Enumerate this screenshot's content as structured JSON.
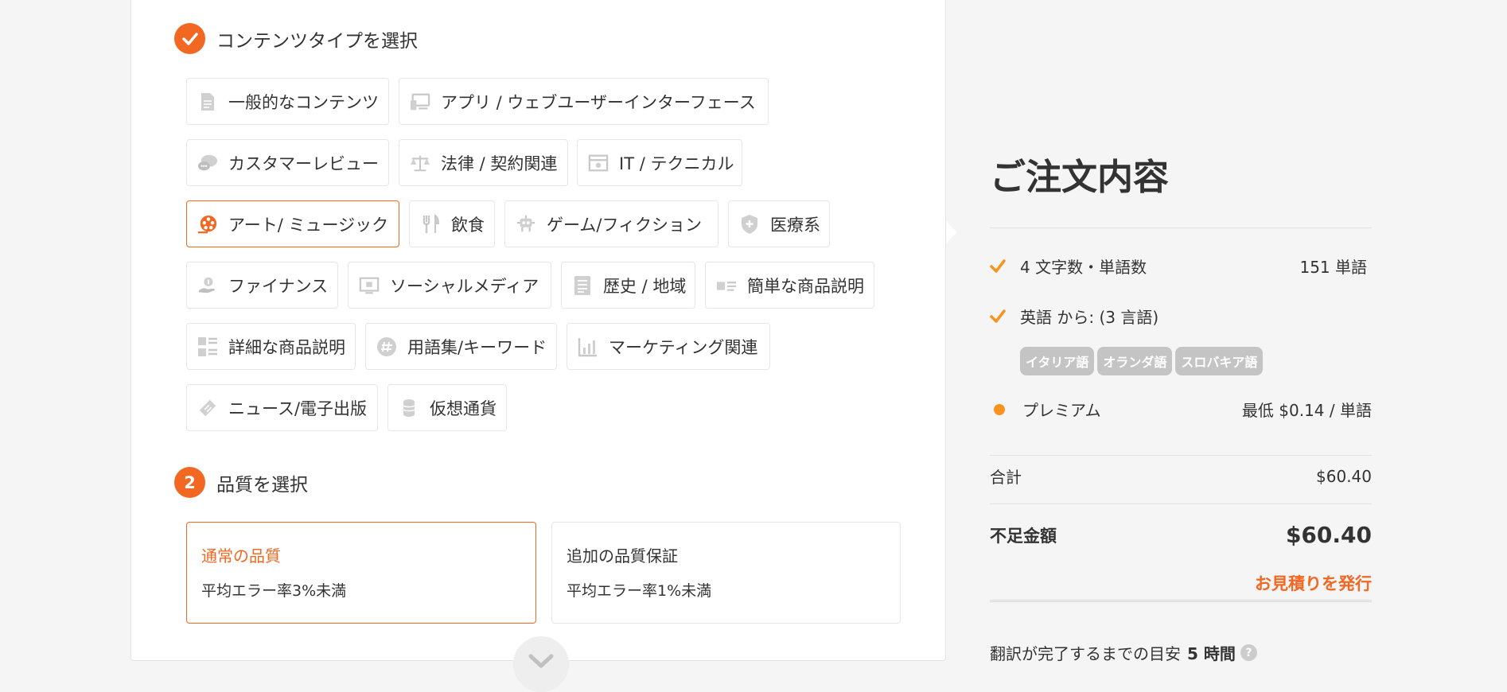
{
  "content_type": {
    "step_title": "コンテンツタイプを選択",
    "chips": [
      {
        "label": "一般的なコンテンツ",
        "icon": "document-icon"
      },
      {
        "label": "アプリ / ウェブユーザーインターフェース",
        "icon": "devices-icon"
      },
      {
        "label": "カスタマーレビュー",
        "icon": "chat-bubbles-icon"
      },
      {
        "label": "法律 / 契約関連",
        "icon": "scales-icon"
      },
      {
        "label": "IT / テクニカル",
        "icon": "browser-window-icon"
      },
      {
        "label": "アート/ ミュージック",
        "icon": "film-reel-icon",
        "selected": true
      },
      {
        "label": "飲食",
        "icon": "cutlery-icon"
      },
      {
        "label": "ゲーム/フィクション",
        "icon": "robot-icon"
      },
      {
        "label": "医療系",
        "icon": "medical-shield-icon"
      },
      {
        "label": "ファイナンス",
        "icon": "money-hand-icon"
      },
      {
        "label": "ソーシャルメディア",
        "icon": "monitor-icon"
      },
      {
        "label": "歴史 / 地域",
        "icon": "newspaper-icon"
      },
      {
        "label": "簡単な商品説明",
        "icon": "product-list-icon"
      },
      {
        "label": "詳細な商品説明",
        "icon": "product-grid-icon"
      },
      {
        "label": "用語集/キーワード",
        "icon": "hashtag-icon"
      },
      {
        "label": "マーケティング関連",
        "icon": "bar-chart-icon"
      },
      {
        "label": "ニュース/電子出版",
        "icon": "ticket-icon"
      },
      {
        "label": "仮想通貨",
        "icon": "coin-stack-icon"
      }
    ]
  },
  "quality": {
    "step_number": "2",
    "step_title": "品質を選択",
    "options": [
      {
        "title": "通常の品質",
        "desc": "平均エラー率3%未満",
        "selected": true
      },
      {
        "title": "追加の品質保証",
        "desc": "平均エラー率1%未満",
        "selected": false
      }
    ]
  },
  "order": {
    "title": "ご注文内容",
    "word_count_label": "4 文字数・単語数",
    "word_count_value": "151 単語",
    "languages_label": "英語 から: (3 言語)",
    "languages": [
      "イタリア語",
      "オランダ語",
      "スロバキア語"
    ],
    "tier_label": "プレミアム",
    "tier_price": "最低 $0.14 / 単語",
    "subtotal_label": "合計",
    "subtotal_value": "$60.40",
    "due_label": "不足金額",
    "due_value": "$60.40",
    "quote_link": "お見積りを発行",
    "eta_text": "翻訳が完了するまでの目安",
    "eta_value": "5 時間",
    "help_glyph": "?"
  },
  "colors": {
    "accent": "#f26722",
    "dot": "#f7941d",
    "tag": "#c4c4c4"
  }
}
